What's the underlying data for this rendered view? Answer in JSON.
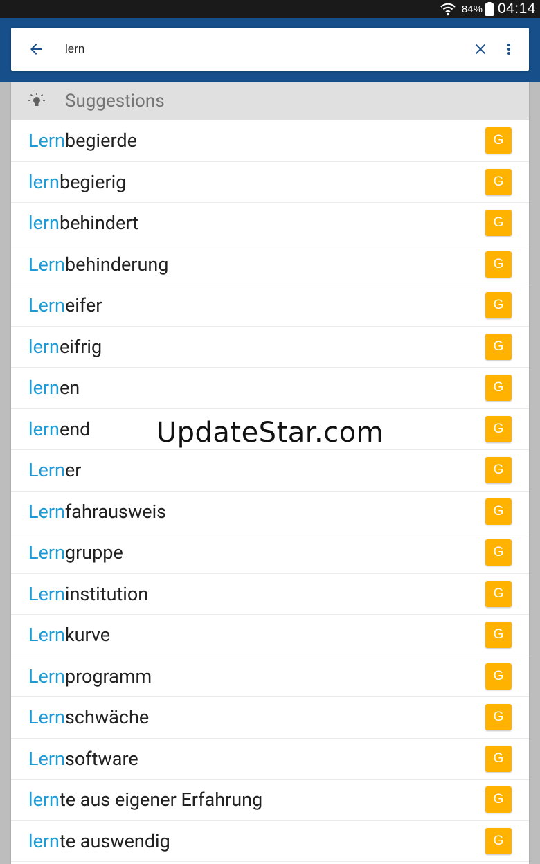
{
  "status_bar": {
    "battery_percent": "84%",
    "time": "04:14",
    "icons": [
      "wifi-icon",
      "battery-icon"
    ]
  },
  "search": {
    "query": "lern",
    "back_icon": "arrow-left-icon",
    "clear_icon": "close-icon",
    "more_icon": "more-vert-icon"
  },
  "suggestions": {
    "header_title": "Suggestions",
    "header_icon": "lightbulb-icon",
    "button_label": "G",
    "button_color": "#ffb300",
    "highlight_color": "#1e9bd7",
    "items": [
      {
        "prefix": "Lern",
        "rest": "begierde"
      },
      {
        "prefix": "lern",
        "rest": "begierig"
      },
      {
        "prefix": "lern",
        "rest": "behindert"
      },
      {
        "prefix": "Lern",
        "rest": "behinderung"
      },
      {
        "prefix": "Lern",
        "rest": "eifer"
      },
      {
        "prefix": "lern",
        "rest": "eifrig"
      },
      {
        "prefix": "lern",
        "rest": "en"
      },
      {
        "prefix": "lern",
        "rest": "end"
      },
      {
        "prefix": "Lern",
        "rest": "er"
      },
      {
        "prefix": "Lern",
        "rest": "fahrausweis"
      },
      {
        "prefix": "Lern",
        "rest": "gruppe"
      },
      {
        "prefix": "Lern",
        "rest": "institution"
      },
      {
        "prefix": "Lern",
        "rest": "kurve"
      },
      {
        "prefix": "Lern",
        "rest": "programm"
      },
      {
        "prefix": "Lern",
        "rest": "schwäche"
      },
      {
        "prefix": "Lern",
        "rest": "software"
      },
      {
        "prefix": "lern",
        "rest": "te aus eigener Erfahrung"
      },
      {
        "prefix": "lern",
        "rest": "te auswendig"
      }
    ]
  },
  "watermark": "UpdateStar.com"
}
